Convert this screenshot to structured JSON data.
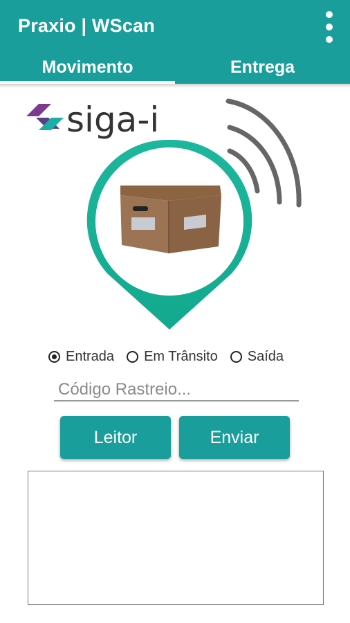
{
  "app": {
    "title": "Praxio | WScan",
    "menu_icon": "more-vert-icon"
  },
  "tabs": [
    {
      "label": "Movimento",
      "active": true
    },
    {
      "label": "Entrega",
      "active": false
    }
  ],
  "logo": {
    "text": "siga-i",
    "icon": "siga-logo-icon"
  },
  "movement_type": {
    "options": [
      {
        "label": "Entrada",
        "checked": true
      },
      {
        "label": "Em Trânsito",
        "checked": false
      },
      {
        "label": "Saída",
        "checked": false
      }
    ]
  },
  "tracking": {
    "placeholder": "Código Rastreio...",
    "value": ""
  },
  "actions": {
    "reader_label": "Leitor",
    "send_label": "Enviar"
  },
  "colors": {
    "primary": "#1a9e9b",
    "accent": "#1abc9c",
    "logo_purple": "#7b3a8e"
  }
}
